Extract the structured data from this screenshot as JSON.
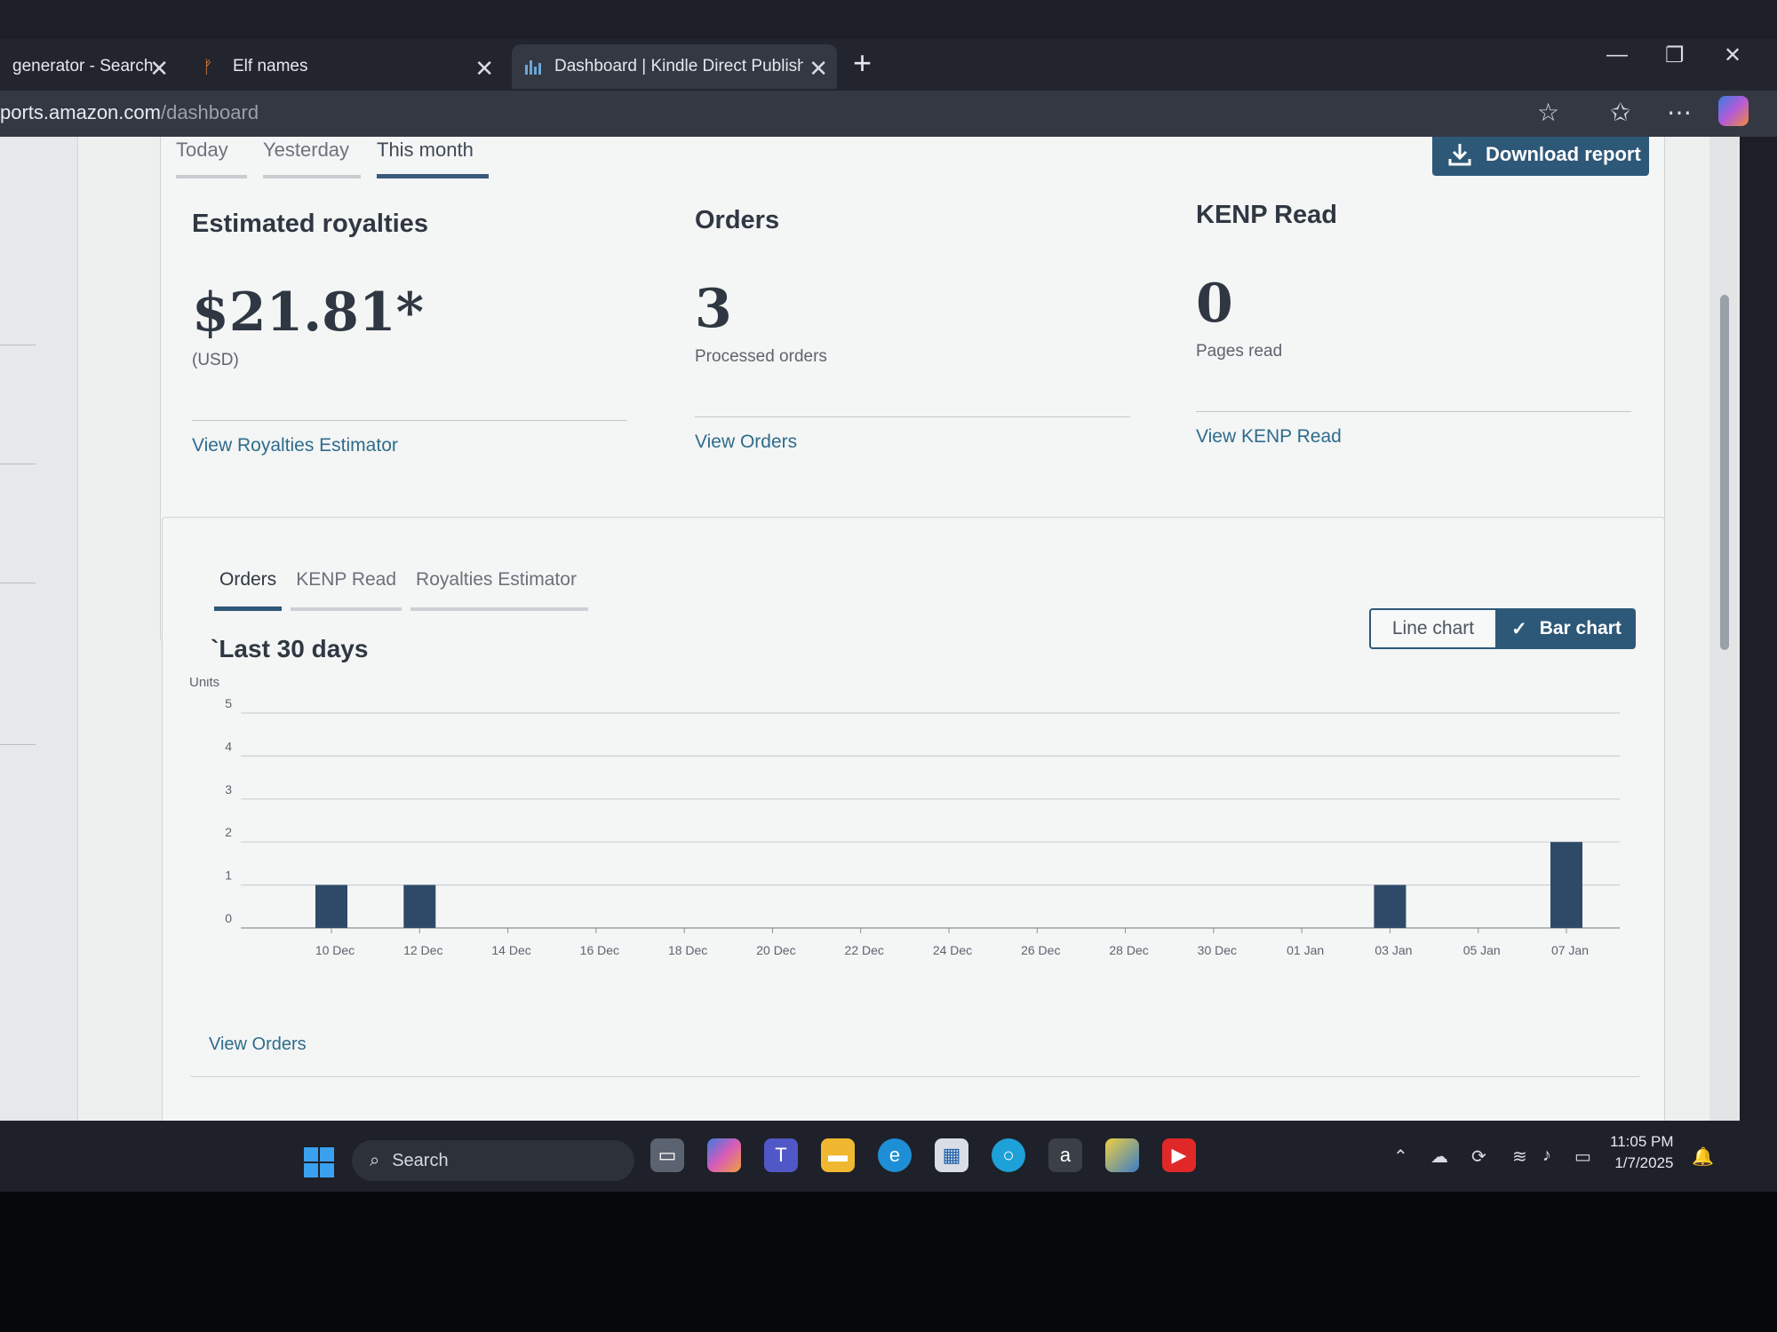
{
  "browser": {
    "tabs": [
      {
        "label": "generator - Search"
      },
      {
        "label": "Elf names"
      },
      {
        "label": "Dashboard | Kindle Direct Publish"
      }
    ],
    "url_host": "ports.amazon.com",
    "url_path": "/dashboard"
  },
  "periods": {
    "items": [
      "Today",
      "Yesterday",
      "This month"
    ],
    "selected": "This month"
  },
  "download_label": "Download report",
  "metrics": {
    "royalties": {
      "title": "Estimated royalties",
      "value": "$21.81*",
      "sub": "(USD)",
      "link": "View Royalties Estimator"
    },
    "orders": {
      "title": "Orders",
      "value": "3",
      "sub": "Processed orders",
      "link": "View Orders"
    },
    "kenp": {
      "title": "KENP Read",
      "value": "0",
      "sub": "Pages read",
      "link": "View KENP Read"
    }
  },
  "chart_tabs": {
    "items": [
      "Orders",
      "KENP Read",
      "Royalties Estimator"
    ],
    "selected": "Orders"
  },
  "chart_title": "`Last 30 days",
  "toggle": {
    "line": "Line chart",
    "bar": "Bar chart",
    "selected": "Bar chart"
  },
  "chart_view_link": "View Orders",
  "chart_data": {
    "type": "bar",
    "ylabel": "Units",
    "ylim": [
      0,
      5
    ],
    "yticks": [
      0,
      1,
      2,
      3,
      4,
      5
    ],
    "x_tick_labels": [
      "10 Dec",
      "12 Dec",
      "14 Dec",
      "16 Dec",
      "18 Dec",
      "20 Dec",
      "22 Dec",
      "24 Dec",
      "26 Dec",
      "28 Dec",
      "30 Dec",
      "01 Jan",
      "03 Jan",
      "05 Jan",
      "07 Jan"
    ],
    "categories": [
      "10 Dec",
      "11 Dec",
      "12 Dec",
      "13 Dec",
      "14 Dec",
      "15 Dec",
      "16 Dec",
      "17 Dec",
      "18 Dec",
      "19 Dec",
      "20 Dec",
      "21 Dec",
      "22 Dec",
      "23 Dec",
      "24 Dec",
      "25 Dec",
      "26 Dec",
      "27 Dec",
      "28 Dec",
      "29 Dec",
      "30 Dec",
      "31 Dec",
      "01 Jan",
      "02 Jan",
      "03 Jan",
      "04 Jan",
      "05 Jan",
      "06 Jan",
      "07 Jan"
    ],
    "values": [
      1,
      0,
      1,
      0,
      0,
      0,
      0,
      0,
      0,
      0,
      0,
      0,
      0,
      0,
      0,
      0,
      0,
      0,
      0,
      0,
      0,
      0,
      0,
      0,
      1,
      0,
      0,
      0,
      2
    ],
    "grid": true,
    "bar_color": "#2e4a68"
  },
  "taskbar": {
    "search_label": "Search",
    "time": "11:05 PM",
    "date": "1/7/2025"
  },
  "colors": {
    "accent": "#2e5878",
    "link": "#2e6c8c"
  }
}
